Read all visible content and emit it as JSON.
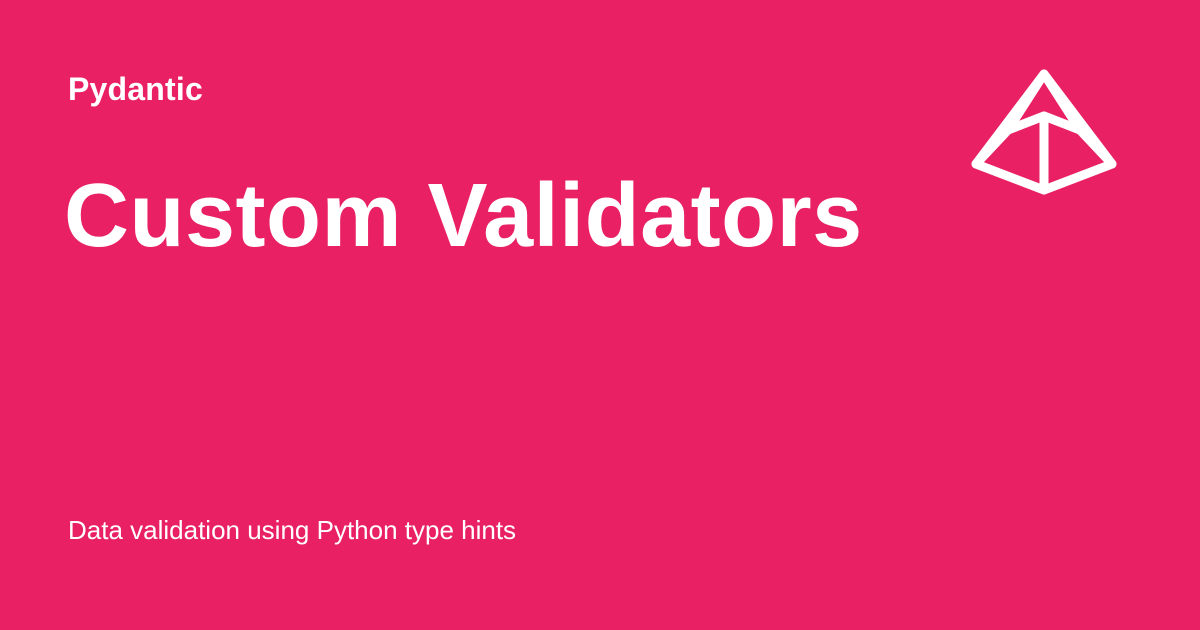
{
  "card": {
    "site_name": "Pydantic",
    "title": "Custom Validators",
    "description": "Data validation using Python type hints",
    "logo_icon": "pydantic-pyramid-icon",
    "background_color": "#e92063",
    "text_color": "#ffffff"
  }
}
